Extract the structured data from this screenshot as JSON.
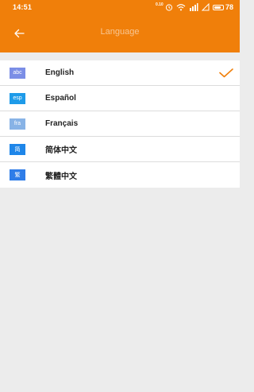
{
  "status_bar": {
    "time": "14:51",
    "battery": "78",
    "data_indicator": "0.10"
  },
  "app_bar": {
    "title": "Language"
  },
  "languages": [
    {
      "badge": "abc",
      "label": "English",
      "selected": true,
      "badge_color": "#7b8ee6"
    },
    {
      "badge": "esp",
      "label": "Español",
      "selected": false,
      "badge_color": "#1e9be9"
    },
    {
      "badge": "fra",
      "label": "Français",
      "selected": false,
      "badge_color": "#88b3e6"
    },
    {
      "badge": "简",
      "label": "简体中文",
      "selected": false,
      "badge_color": "#1e86e9"
    },
    {
      "badge": "繁",
      "label": "繁體中文",
      "selected": false,
      "badge_color": "#2f7de8"
    }
  ],
  "colors": {
    "accent": "#f07f0a",
    "background": "#ececec"
  }
}
